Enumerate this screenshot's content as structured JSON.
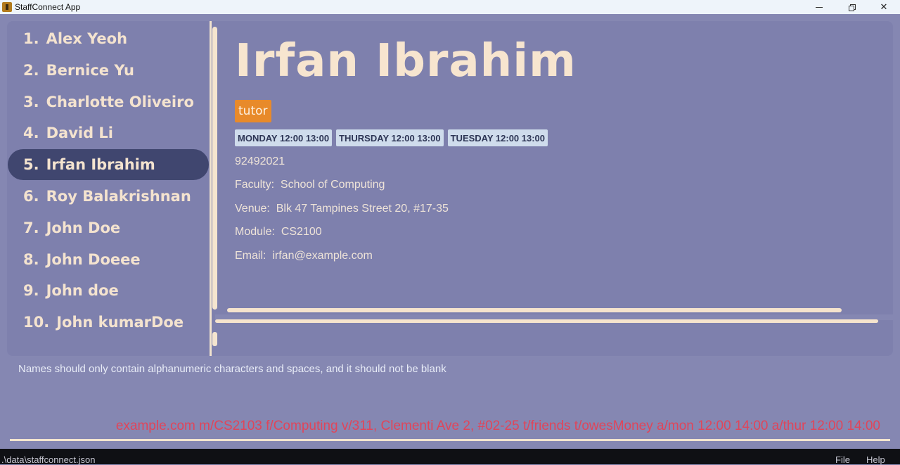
{
  "window": {
    "title": "StaffConnect App"
  },
  "persons": [
    {
      "index": "1.",
      "name": "Alex Yeoh"
    },
    {
      "index": "2.",
      "name": "Bernice Yu"
    },
    {
      "index": "3.",
      "name": "Charlotte Oliveiro"
    },
    {
      "index": "4.",
      "name": "David Li"
    },
    {
      "index": "5.",
      "name": "Irfan Ibrahim"
    },
    {
      "index": "6.",
      "name": "Roy Balakrishnan"
    },
    {
      "index": "7.",
      "name": "John Doe"
    },
    {
      "index": "8.",
      "name": "John Doeee"
    },
    {
      "index": "9.",
      "name": "John doe"
    },
    {
      "index": "10.",
      "name": "John kumarDoe"
    }
  ],
  "selected_index": 4,
  "detail": {
    "name": "Irfan Ibrahim",
    "tag": "tutor",
    "availabilities": [
      "MONDAY 12:00 13:00",
      "THURSDAY 12:00 13:00",
      "TUESDAY 12:00 13:00"
    ],
    "phone": "92492021",
    "faculty_label": "Faculty:",
    "faculty": "School of Computing",
    "venue_label": "Venue:",
    "venue": "Blk 47 Tampines Street 20, #17-35",
    "module_label": "Module:",
    "module": "CS2100",
    "email_label": "Email:",
    "email": "irfan@example.com"
  },
  "result_message": "Names should only contain alphanumeric characters and spaces, and it should not be blank",
  "command_text": "example.com m/CS2103 f/Computing v/311, Clementi Ave 2, #02-25 t/friends t/owesMoney a/mon 12:00 14:00 a/thur 12:00 14:00",
  "status": {
    "path": ".\\data\\staffconnect.json"
  },
  "menu": {
    "file": "File",
    "help": "Help"
  },
  "colors": {
    "background": "#8587b2",
    "panel": "#7e80ad",
    "selected": "#40466f",
    "tag": "#e88a2a",
    "availability": "#cfdcec",
    "command_text": "#e0455a"
  }
}
